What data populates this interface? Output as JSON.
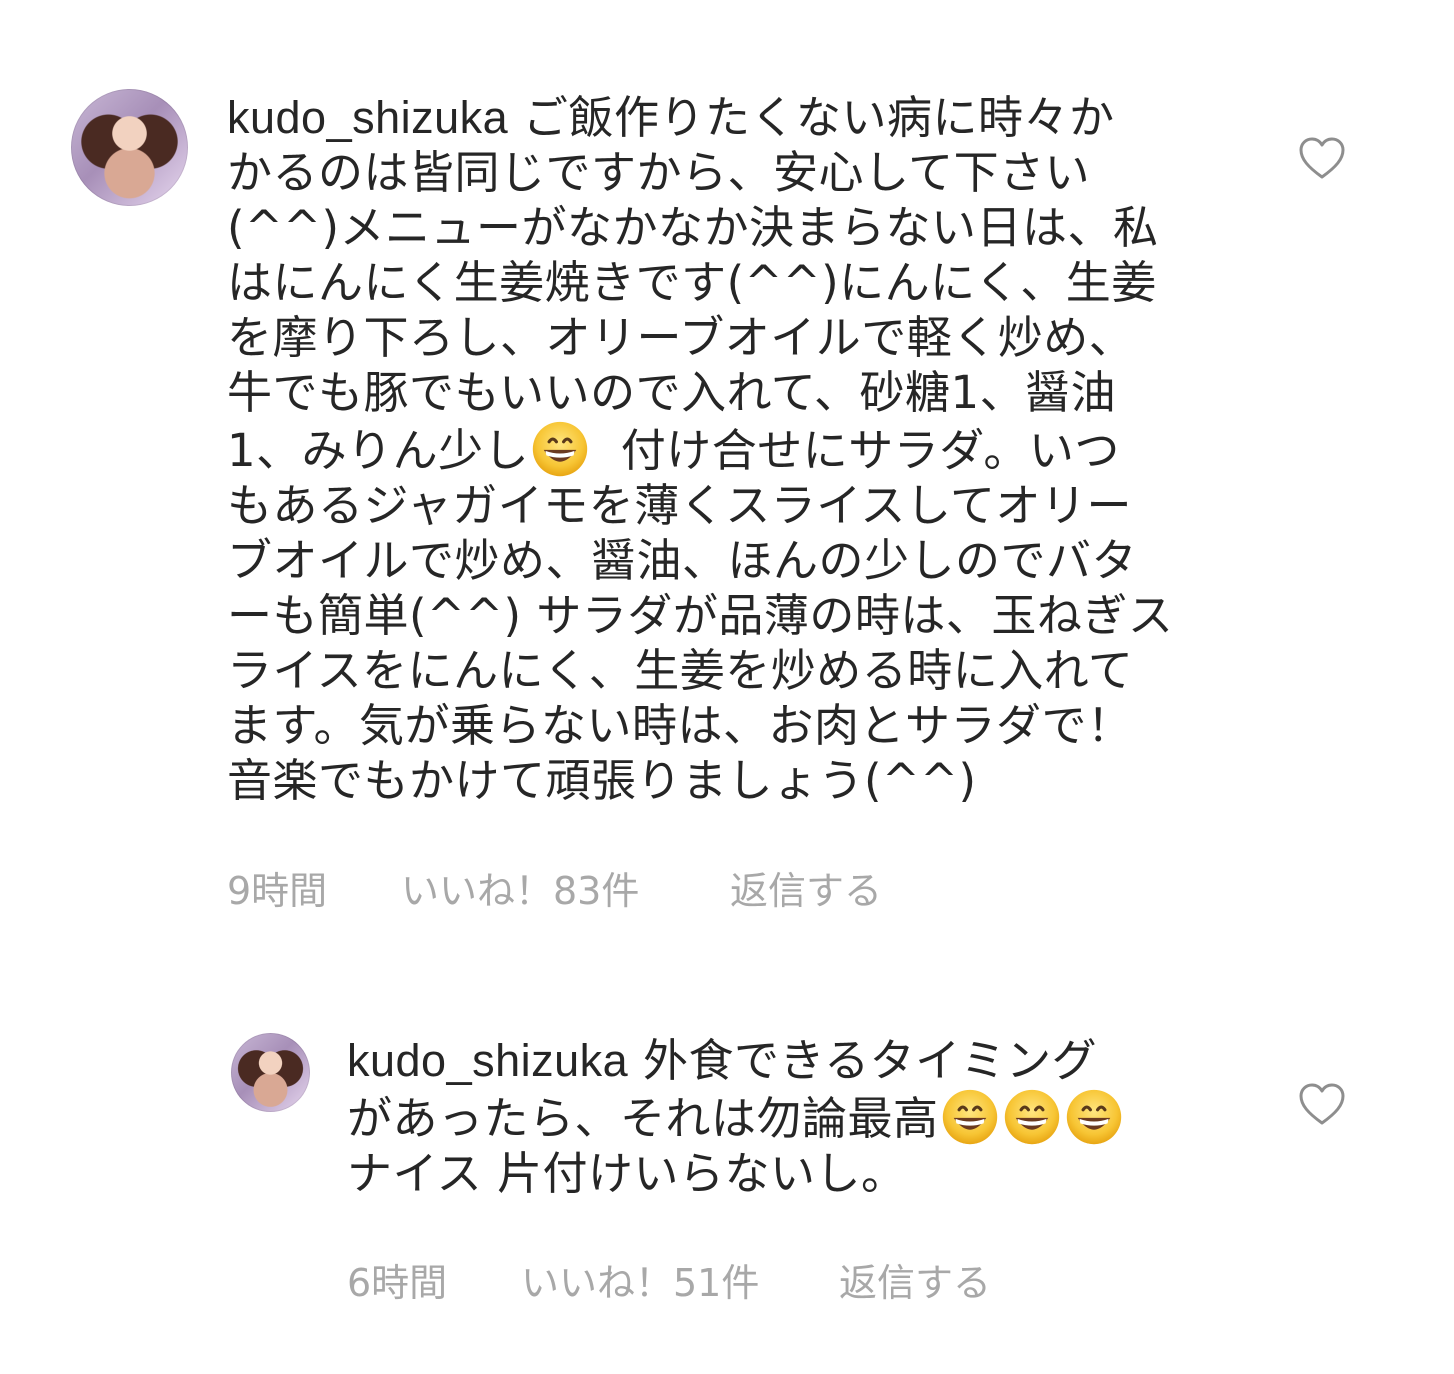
{
  "comments": [
    {
      "username": "kudo_shizuka",
      "lines": [
        "ご飯作りたくない病に時々か",
        "かるのは皆同じですから、安心して下さい",
        "(^^)メニューがなかなか決まらない日は、私",
        "はにんにく生姜焼きです(^^)にんにく、生姜",
        "を摩り下ろし、オリーブオイルで軽く炒め、",
        "牛でも豚でもいいので入れて、砂糖1、醤油",
        "1、みりん少し",
        "付け合せにサラダ。いつ",
        "もあるジャガイモを薄くスライスしてオリー",
        "ブオイルで炒め、醤油、ほんの少しのでバタ",
        "ーも簡単(^^) サラダが品薄の時は、玉ねぎス",
        "ライスをにんにく、生姜を炒める時に入れて",
        "ます。気が乗らない時は、お肉とサラダで！",
        "音楽でもかけて頑張りましょう(^^)"
      ],
      "time": "9時間",
      "likes": "いいね！83件",
      "reply": "返信する",
      "emoji": "grinning-face-emoji"
    },
    {
      "username": "kudo_shizuka",
      "lines": [
        "外食できるタイミング",
        "があったら、それは勿論最高",
        "ナイス 片付けいらないし。"
      ],
      "time": "6時間",
      "likes": "いいね！51件",
      "reply": "返信する",
      "emoji": "grinning-face-emoji"
    }
  ],
  "colors": {
    "text": "#262626",
    "meta": "#a8a8a8",
    "heart": "#8e8e8e"
  },
  "icons": {
    "like": "heart-outline-icon",
    "emoji": "grinning-face-emoji"
  }
}
